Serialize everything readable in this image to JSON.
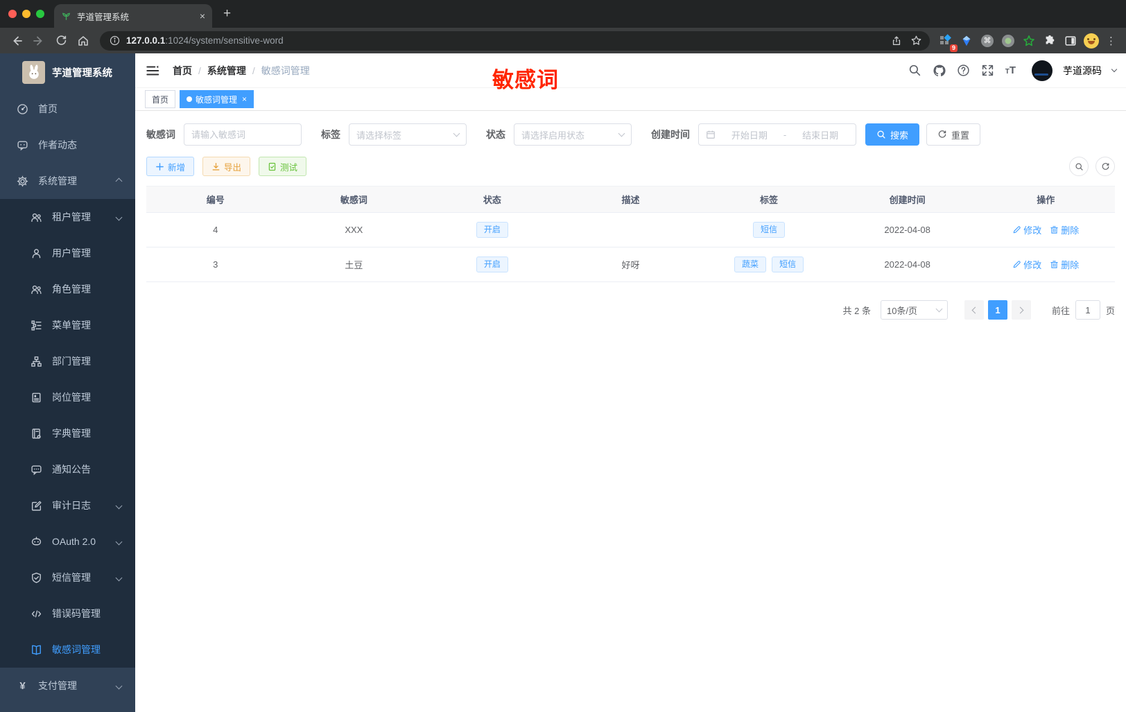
{
  "colors": {
    "accent": "#409eff",
    "sidebar_bg": "#304156",
    "submenu_bg": "#1f2d3d",
    "annotation_red": "#ff2600",
    "warning": "#e6a23c",
    "success": "#67c23a",
    "danger_badge": "#e94235"
  },
  "browser": {
    "tab_title": "芋道管理系统",
    "url_host": "127.0.0.1",
    "url_path": ":1024/system/sensitive-word",
    "ext_badge": "9"
  },
  "icons": {
    "close_glyph": "×",
    "plus_glyph": "+",
    "dots_glyph": "⋮",
    "cmd_glyph": "⌘",
    "pay_glyph": "¥",
    "code_glyph": "</>"
  },
  "sidebar": {
    "title": "芋道管理系统",
    "items": [
      {
        "label": "首页"
      },
      {
        "label": "作者动态"
      },
      {
        "label": "系统管理"
      },
      {
        "label": "租户管理"
      },
      {
        "label": "用户管理"
      },
      {
        "label": "角色管理"
      },
      {
        "label": "菜单管理"
      },
      {
        "label": "部门管理"
      },
      {
        "label": "岗位管理"
      },
      {
        "label": "字典管理"
      },
      {
        "label": "通知公告"
      },
      {
        "label": "审计日志"
      },
      {
        "label": "OAuth 2.0"
      },
      {
        "label": "短信管理"
      },
      {
        "label": "错误码管理"
      },
      {
        "label": "敏感词管理"
      },
      {
        "label": "支付管理"
      }
    ]
  },
  "navbar": {
    "breadcrumb": {
      "home": "首页",
      "section": "系统管理",
      "current": "敏感词管理",
      "sep": "/"
    },
    "annotation": "敏感词",
    "username": "芋道源码"
  },
  "tagsbar": {
    "home": "首页",
    "active": "敏感词管理"
  },
  "filters": {
    "word_label": "敏感词",
    "word_placeholder": "请输入敏感词",
    "tag_label": "标签",
    "tag_placeholder": "请选择标签",
    "status_label": "状态",
    "status_placeholder": "请选择启用状态",
    "created_label": "创建时间",
    "start_placeholder": "开始日期",
    "range_sep": "-",
    "end_placeholder": "结束日期",
    "search": "搜索",
    "reset": "重置"
  },
  "toolbar": {
    "add": "新增",
    "export": "导出",
    "test": "测试"
  },
  "table": {
    "headers": [
      "编号",
      "敏感词",
      "状态",
      "描述",
      "标签",
      "创建时间",
      "操作"
    ],
    "actions": {
      "edit": "修改",
      "delete": "删除"
    },
    "rows": [
      {
        "id": "4",
        "word": "XXX",
        "status": "开启",
        "desc": "",
        "tags": [
          "短信"
        ],
        "created": "2022-04-08"
      },
      {
        "id": "3",
        "word": "土豆",
        "status": "开启",
        "desc": "好呀",
        "tags": [
          "蔬菜",
          "短信"
        ],
        "created": "2022-04-08"
      }
    ]
  },
  "pagination": {
    "total": "共 2 条",
    "page_size": "10条/页",
    "current_page": "1",
    "goto_label": "前往",
    "goto_value": "1",
    "page_unit": "页"
  }
}
